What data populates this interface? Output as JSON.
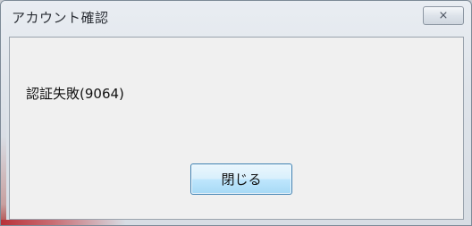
{
  "window": {
    "title": "アカウント確認",
    "close_glyph": "⨯"
  },
  "dialog": {
    "message": "認証失敗(9064)",
    "close_button_label": "閉じる"
  },
  "colors": {
    "accent_red": "#b8323a",
    "button_border": "#3c7fb1"
  }
}
